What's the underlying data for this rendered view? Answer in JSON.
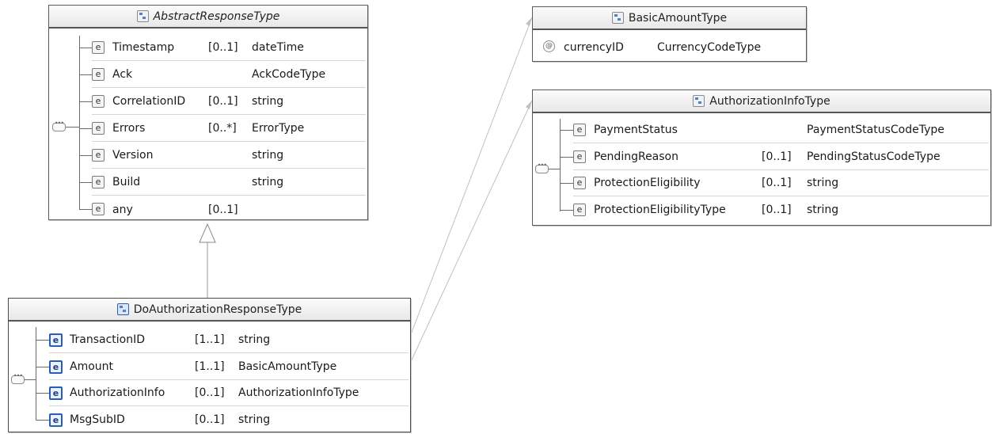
{
  "abstract_response": {
    "title": "AbstractResponseType",
    "rows": [
      {
        "name": "Timestamp",
        "card": "[0..1]",
        "type": "dateTime",
        "icon": "element-icon"
      },
      {
        "name": "Ack",
        "card": "",
        "type": "AckCodeType",
        "icon": "element-icon"
      },
      {
        "name": "CorrelationID",
        "card": "[0..1]",
        "type": "string",
        "icon": "element-icon"
      },
      {
        "name": "Errors",
        "card": "[0..*]",
        "type": "ErrorType",
        "icon": "element-icon"
      },
      {
        "name": "Version",
        "card": "",
        "type": "string",
        "icon": "element-icon"
      },
      {
        "name": "Build",
        "card": "",
        "type": "string",
        "icon": "element-icon"
      },
      {
        "name": "any",
        "card": "[0..1]",
        "type": "",
        "icon": "any-element-icon"
      }
    ]
  },
  "do_authorization_response": {
    "title": "DoAuthorizationResponseType",
    "rows": [
      {
        "name": "TransactionID",
        "card": "[1..1]",
        "type": "string",
        "icon": "element-icon"
      },
      {
        "name": "Amount",
        "card": "[1..1]",
        "type": "BasicAmountType",
        "icon": "element-icon"
      },
      {
        "name": "AuthorizationInfo",
        "card": "[0..1]",
        "type": "AuthorizationInfoType",
        "icon": "complex-element-icon"
      },
      {
        "name": "MsgSubID",
        "card": "[0..1]",
        "type": "string",
        "icon": "element-icon"
      }
    ]
  },
  "basic_amount": {
    "title": "BasicAmountType",
    "rows": [
      {
        "name": "currencyID",
        "type": "CurrencyCodeType",
        "icon": "attribute-icon"
      }
    ]
  },
  "authorization_info": {
    "title": "AuthorizationInfoType",
    "rows": [
      {
        "name": "PaymentStatus",
        "card": "",
        "type": "PaymentStatusCodeType",
        "icon": "element-icon"
      },
      {
        "name": "PendingReason",
        "card": "[0..1]",
        "type": "PendingStatusCodeType",
        "icon": "element-icon"
      },
      {
        "name": "ProtectionEligibility",
        "card": "[0..1]",
        "type": "string",
        "icon": "element-icon"
      },
      {
        "name": "ProtectionEligibilityType",
        "card": "[0..1]",
        "type": "string",
        "icon": "element-icon"
      }
    ]
  },
  "glyphs": {
    "element": "e",
    "attribute": "@"
  },
  "colors": {
    "border": "#5a5a5a",
    "header_bg": "#efefef",
    "connector": "#b0b0b0",
    "accent_blue": "#2a5fb0"
  }
}
